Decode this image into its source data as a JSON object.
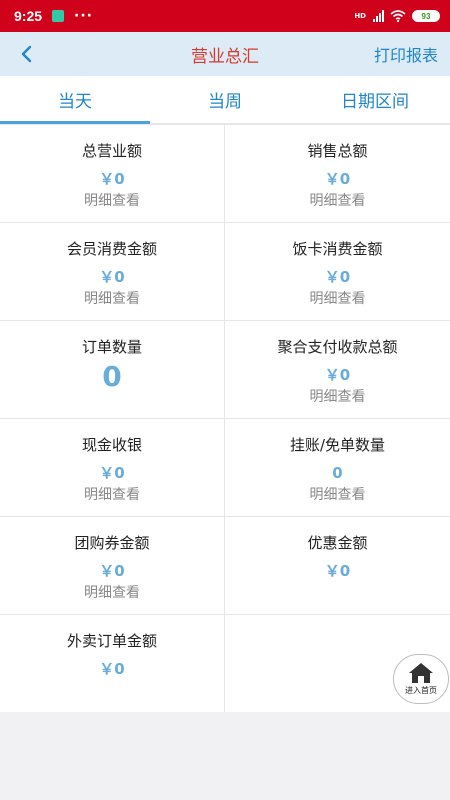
{
  "status_bar": {
    "time": "9:25",
    "dots": "···",
    "signal_label": "HD",
    "battery": "93"
  },
  "nav": {
    "back_icon": "chevron-left-icon",
    "title": "营业总汇",
    "print_label": "打印报表"
  },
  "tabs": [
    {
      "label": "当天",
      "active": true
    },
    {
      "label": "当周",
      "active": false
    },
    {
      "label": "日期区间",
      "active": false
    }
  ],
  "cells": [
    {
      "title": "总营业额",
      "value": "￥0",
      "link": "明细查看"
    },
    {
      "title": "销售总额",
      "value": "￥0",
      "link": "明细查看"
    },
    {
      "title": "会员消费金额",
      "value": "￥0",
      "link": "明细查看"
    },
    {
      "title": "饭卡消费金额",
      "value": "￥0",
      "link": "明细查看"
    },
    {
      "title": "订单数量",
      "value": "0"
    },
    {
      "title": "聚合支付收款总额",
      "value": "￥0",
      "link": "明细查看"
    },
    {
      "title": "现金收银",
      "value": "￥0",
      "link": "明细查看"
    },
    {
      "title": "挂账/免单数量",
      "value": "0",
      "link": "明细查看"
    },
    {
      "title": "团购券金额",
      "value": "￥0",
      "link": "明细查看"
    },
    {
      "title": "优惠金额",
      "value": "￥0"
    },
    {
      "title": "外卖订单金额",
      "value": "￥0"
    }
  ],
  "home_button": {
    "label": "进入首页",
    "icon": "home-icon"
  },
  "colors": {
    "status_bar": "#d0021b",
    "nav_bg": "#ddebf7",
    "title_red": "#d7392b",
    "accent_blue": "#1f86c9",
    "value_blue": "#69abd9"
  }
}
